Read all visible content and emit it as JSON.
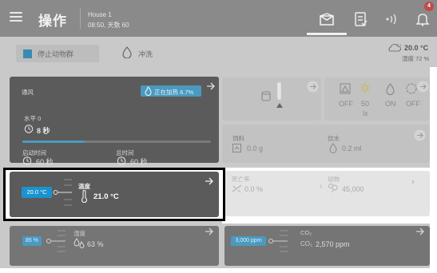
{
  "header": {
    "title": "操作",
    "house_name": "House 1",
    "house_info": "08:50, 天数 60",
    "alarm_count": "4"
  },
  "actions": {
    "stop_label": "停止动物群",
    "wash_label": "冲洗"
  },
  "weather": {
    "temperature": "20.0 °C",
    "humidity": "湿度 72 %"
  },
  "ventilation": {
    "title": "通风",
    "heating_status": "正在加热 6.7%",
    "level_label": "水平 0",
    "level_time": "8 秒",
    "progress": 0.33,
    "start_label": "启动时间",
    "total_label": "总时间",
    "start_time": "60 秒",
    "total_time": "60 秒"
  },
  "light": {
    "off1": "OFF",
    "lux_value": "50",
    "lux_unit": "lx",
    "on": "ON",
    "off2": "OFF"
  },
  "feed": {
    "feed_label": "饲料",
    "feed_value": "0.0 g",
    "water_label": "饮水",
    "water_value": "0.2 ml"
  },
  "temperature": {
    "setpoint": "20.0 °C",
    "label": "温度",
    "value": "21.0 °C"
  },
  "mortality": {
    "label": "死亡率",
    "value": "0.0 %",
    "animals_label": "动物",
    "animals_value": "45,000"
  },
  "humidity": {
    "setpoint": "85 %",
    "label": "湿度",
    "value": "63 %"
  },
  "co2": {
    "setpoint": "3,000 ppm",
    "label": "CO₂",
    "sub": "CO₂",
    "value": "2,570 ppm"
  },
  "colors": {
    "accent": "#1a93d0",
    "header": "#8a8a8a",
    "card_dark": "#5b5b5b",
    "alarm": "#c24a4a"
  }
}
